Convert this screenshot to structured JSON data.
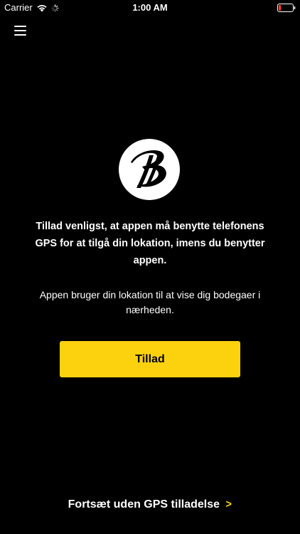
{
  "status_bar": {
    "carrier": "Carrier",
    "time": "1:00 AM",
    "wifi_icon": "wifi-icon",
    "activity_icon": "spinner-icon",
    "battery_icon": "battery-icon",
    "battery_color": "#ff3b30"
  },
  "header": {
    "menu_icon": "hamburger-menu-icon"
  },
  "logo": {
    "icon": "brand-logo-b-icon"
  },
  "permission": {
    "headline": "Tillad venligst, at appen må benytte telefonens GPS for at tilgå din lokation, imens du benytter appen.",
    "description": "Appen bruger din lokation til at vise dig bodegaer i nærheden.",
    "allow_label": "Tillad",
    "continue_label": "Fortsæt uden GPS tilladelse"
  },
  "colors": {
    "background": "#000000",
    "text": "#ffffff",
    "accent": "#fcd20f"
  }
}
